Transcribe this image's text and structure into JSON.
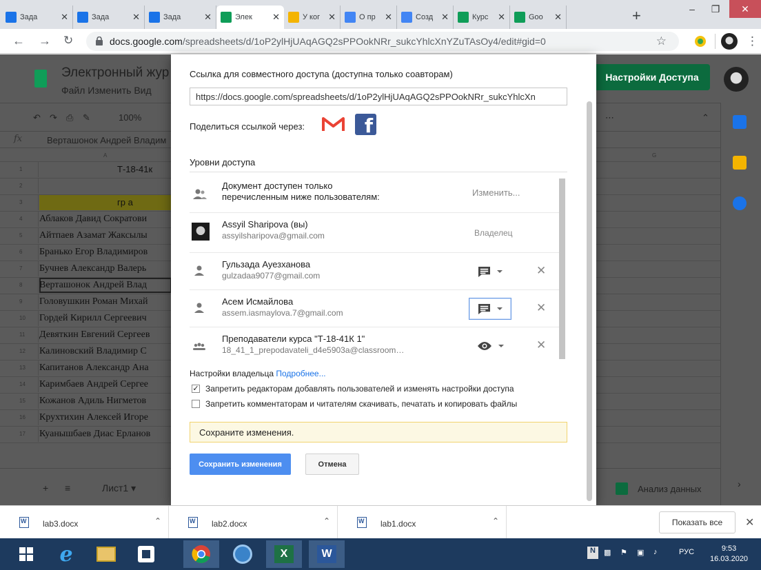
{
  "browser": {
    "tabs": [
      {
        "title": "Зада",
        "color": "#1a73e8"
      },
      {
        "title": "Зада",
        "color": "#1a73e8"
      },
      {
        "title": "Зада",
        "color": "#1a73e8"
      },
      {
        "title": "Элек",
        "color": "#0f9d58"
      },
      {
        "title": "У ког",
        "color": "#f4b400"
      },
      {
        "title": "О пр",
        "color": "#4285f4"
      },
      {
        "title": "Созд",
        "color": "#4285f4"
      },
      {
        "title": "Курс",
        "color": "#0f9d58"
      },
      {
        "title": "Goo",
        "color": "#0f9d58"
      }
    ],
    "url_host": "docs.google.com",
    "url_path": "/spreadsheets/d/1oP2ylHjUAqAGQ2sPPOokNRr_sukcYhlcXnYZuTAsOy4/edit#gid=0"
  },
  "sheets": {
    "title": "Электронный жур",
    "menu": "Файл  Изменить  Вид",
    "share_button": "Настройки Доступа",
    "zoom": "100%",
    "formula_value": "Верташонок Андрей Владим",
    "col_a": "A",
    "col_g": "G",
    "rows": [
      {
        "num": "1",
        "text": "Т-18-41к",
        "center": true
      },
      {
        "num": "2",
        "text": ""
      },
      {
        "num": "3",
        "text": "гр а",
        "center": true,
        "highlight": true
      },
      {
        "num": "4",
        "text": "Аблаков Давид Сократови"
      },
      {
        "num": "5",
        "text": "Айтпаев Азамат Жаксылы"
      },
      {
        "num": "6",
        "text": "Бранько Егор Владимиров"
      },
      {
        "num": "7",
        "text": "Бучнев Александр Валерь"
      },
      {
        "num": "8",
        "text": "Верташонок Андрей Влад",
        "selected": true
      },
      {
        "num": "9",
        "text": "Головушкин Роман Михай"
      },
      {
        "num": "10",
        "text": "Гордей Кирилл Сергеевич"
      },
      {
        "num": "11",
        "text": "Девяткин Евгений Сергеев"
      },
      {
        "num": "12",
        "text": "Калиновский Владимир С"
      },
      {
        "num": "13",
        "text": "Капитанов Александр Ана"
      },
      {
        "num": "14",
        "text": "Каримбаев Андрей Сергее"
      },
      {
        "num": "15",
        "text": "Кожанов Адиль Нигметов"
      },
      {
        "num": "16",
        "text": "Крухтихин Алексей Игоре"
      },
      {
        "num": "17",
        "text": "Куанышбаев Диас Ерланов"
      }
    ],
    "sheet_tab": "Лист1",
    "explore": "Анализ данных"
  },
  "dialog": {
    "link_label": "Ссылка для совместного доступа (доступна только соавторам)",
    "link_value": "https://docs.google.com/spreadsheets/d/1oP2ylHjUAqAGQ2sPPOokNRr_sukcYhlcXn",
    "share_via": "Поделиться ссылкой через:",
    "access_levels": "Уровни доступа",
    "restricted_line1": "Документ доступен только",
    "restricted_line2": "перечисленным ниже пользователям:",
    "change": "Изменить...",
    "users": [
      {
        "name": "Assyil Sharipova (вы)",
        "email": "assyilsharipova@gmail.com",
        "role": "Владелец",
        "kind": "owner"
      },
      {
        "name": "Гульзада Ауезханова",
        "email": "gulzadaa9077@gmail.com",
        "kind": "comment"
      },
      {
        "name": "Асем Исмайлова",
        "email": "assem.iasmaylova.7@gmail.com",
        "kind": "comment-focused"
      },
      {
        "name": "Преподаватели курса \"Т-18-41К 1\"",
        "email": "18_41_1_prepodavateli_d4e5903a@classroom…",
        "kind": "view"
      }
    ],
    "owner_settings": "Настройки владельца",
    "learn_more": "Подробнее...",
    "option1": "Запретить редакторам добавлять пользователей и изменять настройки доступа",
    "option1_checked": true,
    "option2": "Запретить комментаторам и читателям скачивать, печатать и копировать файлы",
    "option2_checked": false,
    "warning": "Сохраните изменения.",
    "save": "Сохранить изменения",
    "cancel": "Отмена"
  },
  "downloads": {
    "files": [
      "lab3.docx",
      "lab2.docx",
      "lab1.docx"
    ],
    "show_all": "Показать все"
  },
  "taskbar": {
    "lang": "РУС",
    "time": "9:53",
    "date": "16.03.2020"
  }
}
